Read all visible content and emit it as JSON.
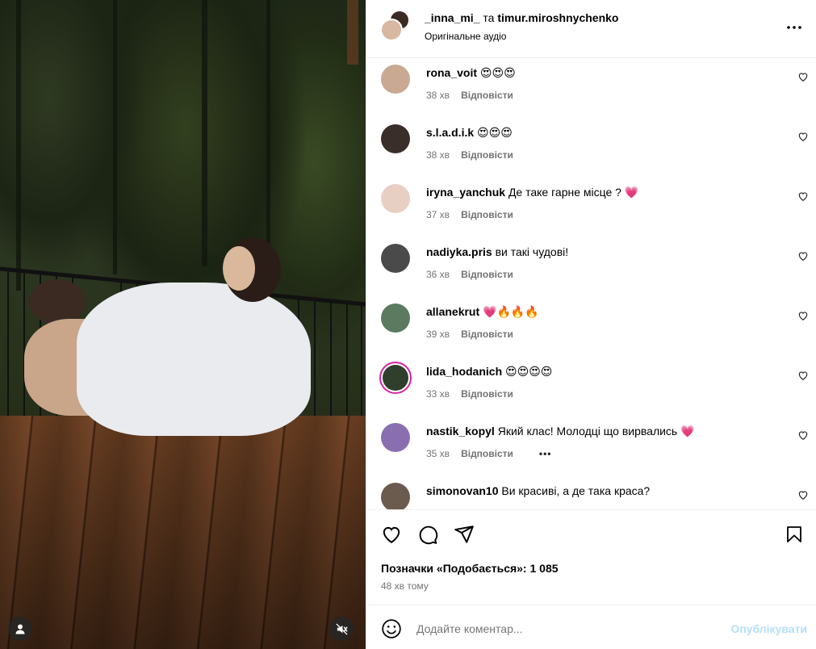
{
  "header": {
    "user1": "_inna_mi_",
    "joiner": "та",
    "user2": "timur.miroshnychenko",
    "subtitle": "Оригінальне аудіо"
  },
  "comments": [
    {
      "user": "rona_voit",
      "text": "😍😍😍",
      "time": "38 хв",
      "reply": "Відповісти"
    },
    {
      "user": "s.l.a.d.i.k",
      "text": "😍😍😍",
      "time": "38 хв",
      "reply": "Відповісти"
    },
    {
      "user": "iryna_yanchuk",
      "text": "Де таке гарне місце ? 💗",
      "time": "37 хв",
      "reply": "Відповісти"
    },
    {
      "user": "nadiyka.pris",
      "text": "ви такі чудові!",
      "time": "36 хв",
      "reply": "Відповісти"
    },
    {
      "user": "allanekrut",
      "text": "💗🔥🔥🔥",
      "time": "39 хв",
      "reply": "Відповісти"
    },
    {
      "user": "lida_hodanich",
      "text": "😍😍😍😍",
      "time": "33 хв",
      "reply": "Відповісти"
    },
    {
      "user": "nastik_kopyl",
      "text": "Який клас! Молодці що вирвались 💗",
      "time": "35 хв",
      "reply": "Відповісти",
      "more": "•••"
    },
    {
      "user": "simonovan10",
      "text": "Ви красиві, а де така краса?",
      "time": "",
      "reply": ""
    }
  ],
  "likes": {
    "label": "Позначки «Подобається»: 1 085",
    "time": "48 хв тому"
  },
  "composer": {
    "placeholder": "Додайте коментар...",
    "post": "Опублікувати"
  },
  "colors": {
    "accent": "#b2dffc",
    "muted": "#737373",
    "heart": "#ff3040"
  },
  "icons": [
    "more-icon",
    "heart-icon",
    "comment-icon",
    "share-icon",
    "bookmark-icon",
    "emoji-icon",
    "user-tag-icon",
    "mute-icon"
  ]
}
